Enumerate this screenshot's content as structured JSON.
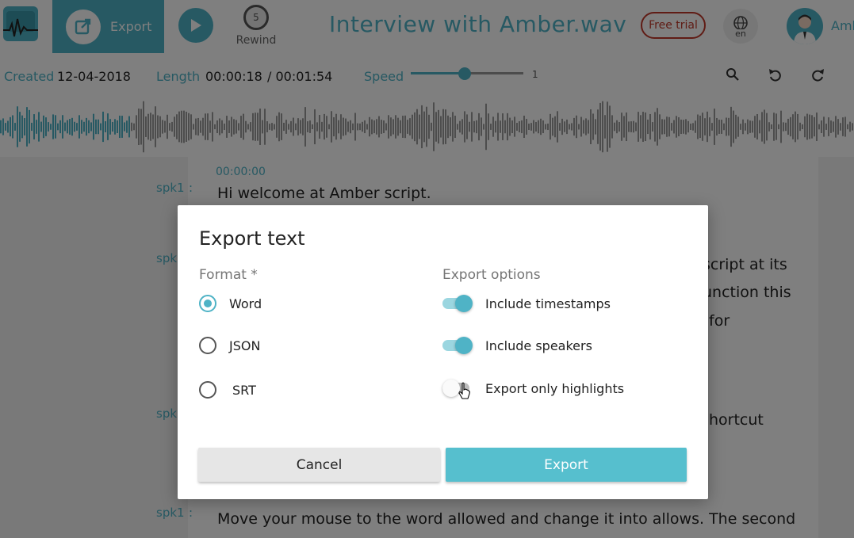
{
  "header": {
    "export_label": "Export",
    "rewind_seconds": "5",
    "rewind_label": "Rewind",
    "title": "Interview with Amber.wav",
    "free_trial_label": "Free trial",
    "language_code": "en",
    "username": "Amb"
  },
  "info": {
    "created_label": "Created",
    "created_value": "12-04-2018",
    "length_label": "Length",
    "length_current": "00:00:18",
    "length_total": "/ 00:01:54",
    "speed_label": "Speed",
    "speed_value": "1"
  },
  "transcript": {
    "segments": [
      {
        "speaker": "spk1",
        "sep": ":",
        "timestamp": "00:00:00",
        "text": "Hi welcome at Amber script."
      },
      {
        "speaker": "spk",
        "text_lines": [
          "script at its",
          "unction this",
          "for"
        ]
      },
      {
        "speaker": "spk",
        "text_lines": [
          "hortcut"
        ]
      },
      {
        "speaker": "spk1",
        "sep": ":",
        "text": "Move your mouse to the word allowed and change it into allows. The second"
      }
    ]
  },
  "dialog": {
    "title": "Export text",
    "format_label": "Format *",
    "formats": [
      {
        "label": "Word",
        "checked": true
      },
      {
        "label": "JSON",
        "checked": false
      },
      {
        "label": "SRT",
        "checked": false
      }
    ],
    "options_label": "Export options",
    "options": [
      {
        "label": "Include timestamps",
        "on": true
      },
      {
        "label": "Include speakers",
        "on": true
      },
      {
        "label": "Export only highlights",
        "on": false
      }
    ],
    "cancel_label": "Cancel",
    "export_label": "Export"
  },
  "colors": {
    "accent": "#4fb3c6",
    "free_trial": "#c0392b",
    "overlay": "rgba(0,0,0,0.5)"
  }
}
